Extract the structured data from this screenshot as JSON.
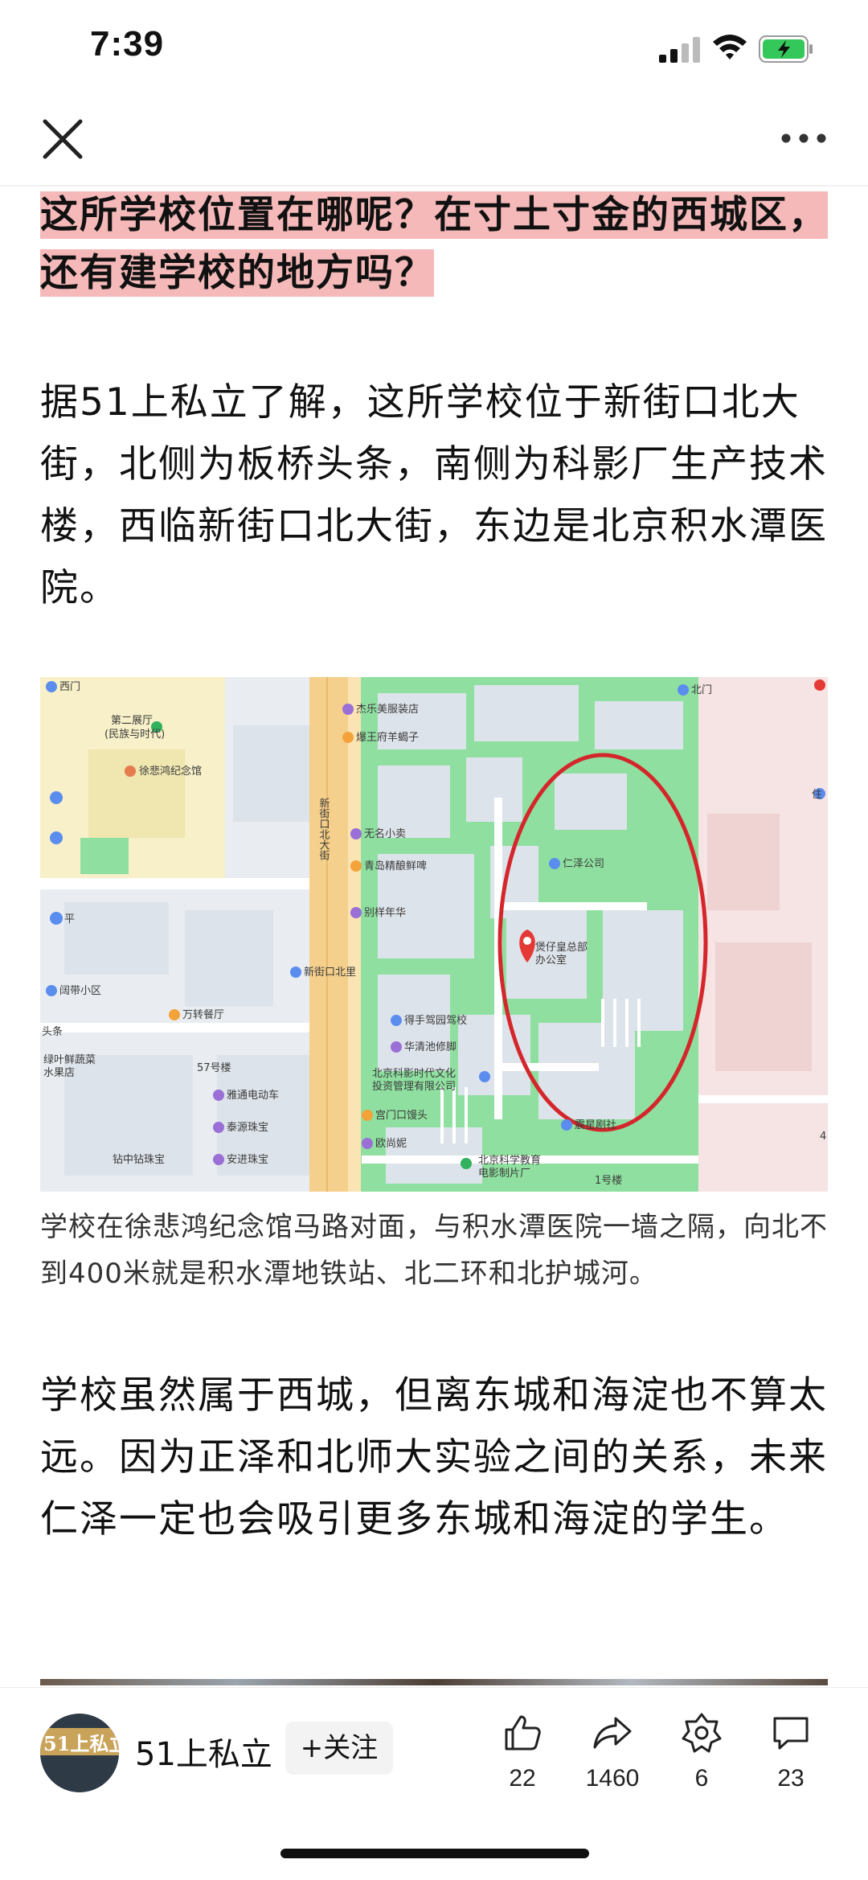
{
  "status_bar": {
    "time": "7:39"
  },
  "article": {
    "highlight": "这所学校位置在哪呢？在寸土寸金的西城区，还有建学校的地方吗？",
    "paragraph1": "据51上私立了解，这所学校位于新街口北大街，北侧为板桥头条，南侧为科影厂生产技术楼，西临新街口北大街，东边是北京积水潭医院。",
    "caption": "学校在徐悲鸿纪念馆马路对面，与积水潭医院一墙之隔，向北不到400米就是积水潭地铁站、北二环和北护城河。",
    "paragraph2": "学校虽然属于西城，但离东城和海淀也不算太远。因为正泽和北师大实验之间的关系，未来仁泽一定也会吸引更多东城和海淀的学生。"
  },
  "map": {
    "labels": {
      "xizhimen": "西门",
      "beimen": "北门",
      "exhibit_hall": "第二展厅",
      "exhibit_hall_sub": "(民族与时代)",
      "xu_memorial": "徐悲鸿纪念馆",
      "jiele": "杰乐美服装店",
      "baodu": "爆王府羊蝎子",
      "road": "新街口北大街",
      "wuming": "无名小卖",
      "qingdao": "青岛精酿鲜啤",
      "bienian": "别样年华",
      "renze": "仁泽公司",
      "hq": "煲仔皇总部",
      "hq_sub": "办公室",
      "xinjiekou_beili": "新街口北里",
      "yangdai": "阔带小区",
      "wanzhuan": "万转餐厅",
      "deshou": "得手驾园驾校",
      "huaqing": "华清池修脚",
      "beijing_film": "北京科影时代文化",
      "beijing_film_sub": "投资管理有限公司",
      "gongmen": "宫门口馒头",
      "oushang": "欧尚妮",
      "zhenxing": "震星剧社",
      "science": "北京科学教育",
      "science_sub": "电影制片厂",
      "lvye": "绿叶鲜蔬菜",
      "lvye_sub": "水果店",
      "yatong": "雅通电动车",
      "taiyuan": "泰源珠宝",
      "zuanzhong": "钻中钻珠宝",
      "anjin": "安进珠宝",
      "building57": "57号楼",
      "building1": "1号楼",
      "tiao": "头条",
      "ping": "平",
      "zhu": "住",
      "four": "4"
    }
  },
  "bottom_bar": {
    "author": "51上私立",
    "avatar_text": "51上私立",
    "follow_label": "+关注",
    "likes": "22",
    "shares": "1460",
    "favorites": "6",
    "comments": "23"
  },
  "colors": {
    "highlight": "#f6b9b9",
    "map_green": "#8fe0a0",
    "map_road": "#f5d08c",
    "circle": "#d4262b",
    "pin": "#e53935"
  }
}
